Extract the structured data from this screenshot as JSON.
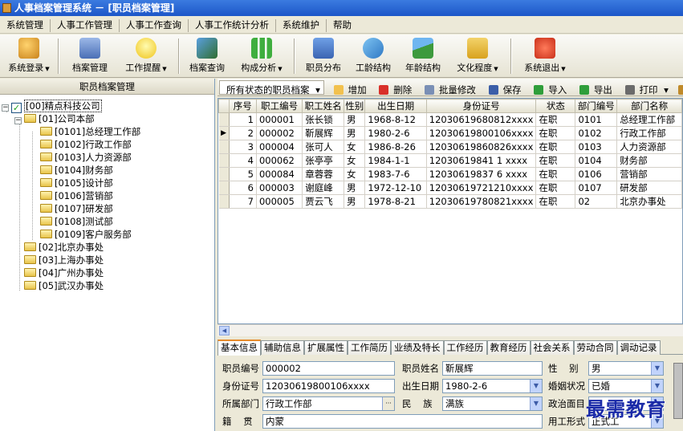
{
  "window": {
    "title": "人事档案管理系统 － [职员档案管理]"
  },
  "menu": [
    "系统管理",
    "人事工作管理",
    "人事工作查询",
    "人事工作统计分析",
    "系统维护",
    "帮助"
  ],
  "toolbar": [
    {
      "label": "系统登录",
      "icon": "key-icon",
      "arrow": true
    },
    {
      "label": "档案管理",
      "icon": "folder-user-icon",
      "arrow": false
    },
    {
      "label": "工作提醒",
      "icon": "bulb-icon",
      "arrow": true
    },
    {
      "label": "档案查询",
      "icon": "search-book-icon",
      "arrow": false
    },
    {
      "label": "构成分析",
      "icon": "bar-chart-icon",
      "arrow": true
    },
    {
      "label": "职员分布",
      "icon": "people-icon",
      "arrow": false
    },
    {
      "label": "工龄结构",
      "icon": "pie-icon",
      "arrow": false
    },
    {
      "label": "年龄结构",
      "icon": "mountain-icon",
      "arrow": false
    },
    {
      "label": "文化程度",
      "icon": "book-icon",
      "arrow": true
    },
    {
      "label": "系统退出",
      "icon": "power-icon",
      "arrow": true
    }
  ],
  "left_panel": {
    "title": "职员档案管理",
    "tree": [
      {
        "label": "[00]精点科技公司",
        "level": 0,
        "checked": true
      },
      {
        "label": "[01]公司本部",
        "level": 1
      },
      {
        "label": "[0101]总经理工作部",
        "level": 2
      },
      {
        "label": "[0102]行政工作部",
        "level": 2
      },
      {
        "label": "[0103]人力资源部",
        "level": 2
      },
      {
        "label": "[0104]财务部",
        "level": 2
      },
      {
        "label": "[0105]设计部",
        "level": 2
      },
      {
        "label": "[0106]营销部",
        "level": 2
      },
      {
        "label": "[0107]研发部",
        "level": 2
      },
      {
        "label": "[0108]测试部",
        "level": 2
      },
      {
        "label": "[0109]客户服务部",
        "level": 2
      },
      {
        "label": "[02]北京办事处",
        "level": 1
      },
      {
        "label": "[03]上海办事处",
        "level": 1
      },
      {
        "label": "[04]广州办事处",
        "level": 1
      },
      {
        "label": "[05]武汉办事处",
        "level": 1
      }
    ]
  },
  "right_toolbar": {
    "filter": "所有状态的职员档案",
    "buttons": [
      {
        "label": "增加",
        "icon": "add-icon",
        "color": "#f2c14e"
      },
      {
        "label": "删除",
        "icon": "delete-icon",
        "color": "#d9302a"
      },
      {
        "label": "批量修改",
        "icon": "batch-edit-icon",
        "color": "#7a8fb5"
      },
      {
        "label": "保存",
        "icon": "save-icon",
        "color": "#3b5ea8"
      },
      {
        "label": "导入",
        "icon": "import-icon",
        "color": "#2f9e3a"
      },
      {
        "label": "导出",
        "icon": "export-icon",
        "color": "#2f9e3a"
      },
      {
        "label": "打印",
        "icon": "print-icon",
        "color": "#6b6b6b"
      },
      {
        "label": "设置",
        "icon": "settings-icon",
        "color": "#c08a2a"
      }
    ]
  },
  "grid": {
    "columns": [
      "序号",
      "职工编号",
      "职工姓名",
      "性别",
      "出生日期",
      "身份证号",
      "状态",
      "部门编号",
      "部门名称"
    ],
    "rows": [
      [
        "1",
        "000001",
        "张长锁",
        "男",
        "1968-8-12",
        "12030619680812xxxx",
        "在职",
        "0101",
        "总经理工作部"
      ],
      [
        "2",
        "000002",
        "靳展辉",
        "男",
        "1980-2-6",
        "12030619800106xxxx",
        "在职",
        "0102",
        "行政工作部"
      ],
      [
        "3",
        "000004",
        "张可人",
        "女",
        "1986-8-26",
        "12030619860826xxxx",
        "在职",
        "0103",
        "人力资源部"
      ],
      [
        "4",
        "000062",
        "张亭亭",
        "女",
        "1984-1-1",
        "12030619841 1 xxxx",
        "在职",
        "0104",
        "财务部"
      ],
      [
        "5",
        "000084",
        "章蓉蓉",
        "女",
        "1983-7-6",
        "12030619837 6 xxxx",
        "在职",
        "0106",
        "营销部"
      ],
      [
        "6",
        "000003",
        "谢庭峰",
        "男",
        "1972-12-10",
        "12030619721210xxxx",
        "在职",
        "0107",
        "研发部"
      ],
      [
        "7",
        "000005",
        "贾云飞",
        "男",
        "1978-8-21",
        "12030619780821xxxx",
        "在职",
        "02",
        "北京办事处"
      ]
    ],
    "selected_row": 1
  },
  "tabs": [
    "基本信息",
    "辅助信息",
    "扩展属性",
    "工作简历",
    "业绩及特长",
    "工作经历",
    "教育经历",
    "社会关系",
    "劳动合同",
    "调动记录"
  ],
  "form": {
    "emp_no_label": "职员编号",
    "emp_no": "000002",
    "name_label": "职员姓名",
    "name": "靳展辉",
    "gender_label": "性    别",
    "gender": "男",
    "id_label": "身份证号",
    "id": "12030619800106xxxx",
    "birth_label": "出生日期",
    "birth": "1980-2-6",
    "marital_label": "婚姻状况",
    "marital": "已婚",
    "dept_label": "所属部门",
    "dept": "行政工作部",
    "nation_label": "民    族",
    "nation": "满族",
    "political_label": "政治面目",
    "political": "",
    "origin_label": "籍    贯",
    "origin": "内蒙",
    "emptype_label": "用工形式",
    "emptype": "正式工"
  },
  "watermark": "最需教育"
}
